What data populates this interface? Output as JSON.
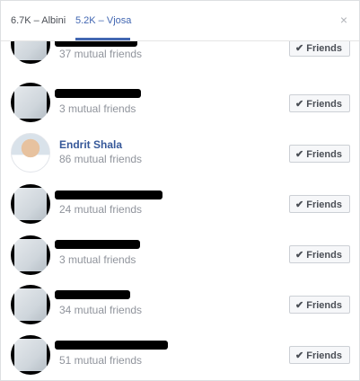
{
  "tabs": [
    {
      "label": "6.7K – Albini"
    },
    {
      "label": "5.2K – Vjosa"
    }
  ],
  "close_glyph": "×",
  "friends_button_label": "Friends",
  "check_glyph": "✔",
  "accent_color": "#4267b2",
  "rows": [
    {
      "name": "",
      "mutual": "37 mutual friends",
      "avatar": "redacted"
    },
    {
      "name": "",
      "mutual": "3 mutual friends",
      "avatar": "redacted"
    },
    {
      "name": "Endrit Shala",
      "mutual": "86 mutual friends",
      "avatar": "photo"
    },
    {
      "name": "",
      "mutual": "24 mutual friends",
      "avatar": "redacted"
    },
    {
      "name": "",
      "mutual": "3 mutual friends",
      "avatar": "redacted"
    },
    {
      "name": "",
      "mutual": "34 mutual friends",
      "avatar": "redacted"
    },
    {
      "name": "",
      "mutual": "51 mutual friends",
      "avatar": "redacted"
    }
  ]
}
